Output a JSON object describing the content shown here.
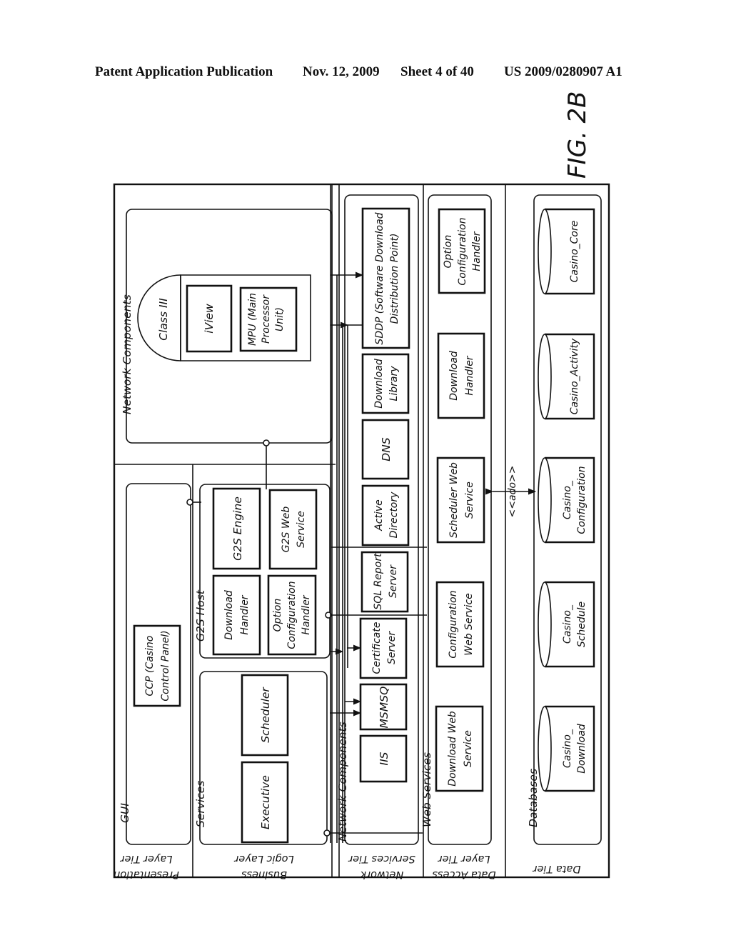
{
  "header": {
    "publication": "Patent Application Publication",
    "date": "Nov. 12, 2009",
    "sheet": "Sheet 4 of 40",
    "number": "US 2009/0280907 A1"
  },
  "figure_label": "FIG. 2B",
  "tiers": [
    {
      "id": "presentation",
      "line1": "Presentation",
      "line2": "Layer Tier"
    },
    {
      "id": "business",
      "line1": "Business",
      "line2": "Logic Layer"
    },
    {
      "id": "network",
      "line1": "Network",
      "line2": "Services Tier"
    },
    {
      "id": "data_access",
      "line1": "Data Access",
      "line2": "Layer Tier"
    },
    {
      "id": "data",
      "line1": "Data Tier",
      "line2": ""
    }
  ],
  "groups": {
    "gui": "GUI",
    "services": "Services",
    "g2s_host": "G2S Host",
    "network_components_top": "Network Components",
    "network_components": "Network Components",
    "web_services": "Web Services",
    "databases": "Databases"
  },
  "presentation": {
    "ccp": [
      "CCP (Casino",
      "Control Panel)"
    ]
  },
  "business": {
    "executive": "Executive",
    "scheduler": "Scheduler",
    "download_handler": [
      "Download",
      "Handler"
    ],
    "option_configuration_handler": [
      "Option",
      "Configuration",
      "Handler"
    ],
    "g2s_engine": "G2S Engine",
    "g2s_web_service": [
      "G2S Web",
      "Service"
    ]
  },
  "class3": {
    "title": "Class III",
    "iview": "iView",
    "mpu": [
      "MPU (Main",
      "Processor",
      "Unit)"
    ]
  },
  "network_services": {
    "iis": "IIS",
    "msmsq": "MSMSQ",
    "certificate_server": [
      "Certificate",
      "Server"
    ],
    "sql_report_server": [
      "SQL Report",
      "Server"
    ],
    "active_directory": [
      "Active",
      "Directory"
    ],
    "dns": "DNS",
    "download_library": [
      "Download",
      "Library"
    ],
    "sddp": [
      "SDDP (Software Download",
      "Distribution Point)"
    ]
  },
  "data_access": {
    "download_web_service": [
      "Download Web",
      "Service"
    ],
    "configuration_web_service": [
      "Configuration",
      "Web Service"
    ],
    "scheduler_web_service": [
      "Scheduler Web",
      "Service"
    ],
    "download_handler": [
      "Download",
      "Handler"
    ],
    "option_configuration_handler": [
      "Option",
      "Configuration",
      "Handler"
    ]
  },
  "connector_label": "<<ado>>",
  "databases": {
    "casino_download": [
      "Casino_",
      "Download"
    ],
    "casino_schedule": [
      "Casino_",
      "Schedule"
    ],
    "casino_configuration": [
      "Casino_",
      "Configuration"
    ],
    "casino_activity": "Casino_Activity",
    "casino_core": "Casino_Core"
  }
}
